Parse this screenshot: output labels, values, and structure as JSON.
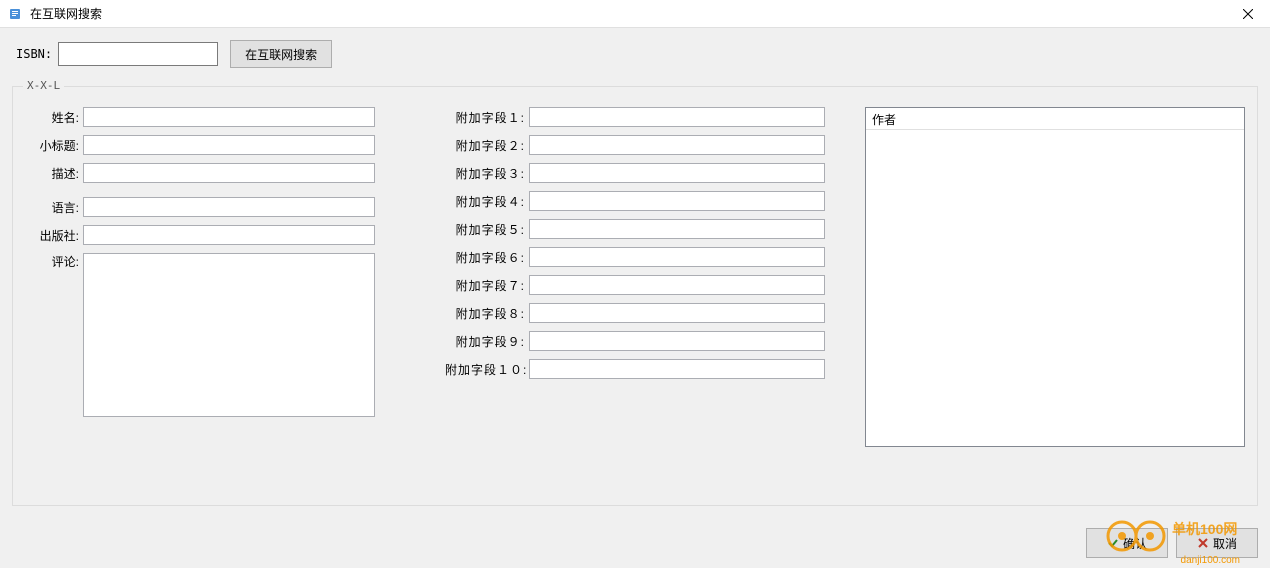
{
  "window": {
    "title": "在互联网搜索"
  },
  "top": {
    "isbn_label": "ISBN:",
    "isbn_value": "",
    "search_button": "在互联网搜索"
  },
  "groupbox_legend": "X-X-L",
  "left_fields": {
    "name_label": "姓名:",
    "name_value": "",
    "subtitle_label": "小标题:",
    "subtitle_value": "",
    "desc_label": "描述:",
    "desc_value": "",
    "language_label": "语言:",
    "language_value": "",
    "publisher_label": "出版社:",
    "publisher_value": "",
    "comment_label": "评论:",
    "comment_value": ""
  },
  "mid_fields": [
    {
      "label": "附加字段１:",
      "value": ""
    },
    {
      "label": "附加字段２:",
      "value": ""
    },
    {
      "label": "附加字段３:",
      "value": ""
    },
    {
      "label": "附加字段４:",
      "value": ""
    },
    {
      "label": "附加字段５:",
      "value": ""
    },
    {
      "label": "附加字段６:",
      "value": ""
    },
    {
      "label": "附加字段７:",
      "value": ""
    },
    {
      "label": "附加字段８:",
      "value": ""
    },
    {
      "label": "附加字段９:",
      "value": ""
    },
    {
      "label": "附加字段１０:",
      "value": ""
    }
  ],
  "listbox": {
    "header": "作者"
  },
  "footer": {
    "ok_label": "确认",
    "cancel_label": "取消"
  },
  "watermark": {
    "text": "单机100网",
    "url": "danji100.com"
  }
}
